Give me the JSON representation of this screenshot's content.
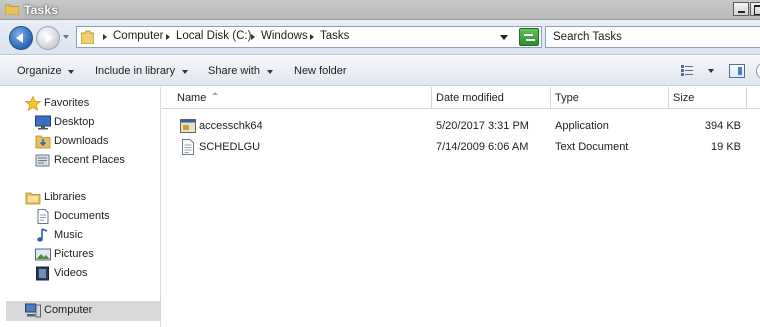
{
  "window": {
    "title": "Tasks"
  },
  "address_bar": {
    "crumbs": [
      "Computer",
      "Local Disk (C:)",
      "Windows",
      "Tasks"
    ]
  },
  "search": {
    "placeholder": "Search Tasks"
  },
  "toolbar": {
    "organize": "Organize",
    "include_in_library": "Include in library",
    "share_with": "Share with",
    "new_folder": "New folder"
  },
  "navigation": {
    "favorites_header": "Favorites",
    "favorites": [
      "Desktop",
      "Downloads",
      "Recent Places"
    ],
    "libraries_header": "Libraries",
    "libraries": [
      "Documents",
      "Music",
      "Pictures",
      "Videos"
    ],
    "computer": "Computer"
  },
  "columns": {
    "name": "Name",
    "date_modified": "Date modified",
    "type": "Type",
    "size": "Size"
  },
  "files": [
    {
      "name": "accesschk64",
      "date_modified": "5/20/2017 3:31 PM",
      "type": "Application",
      "size": "394 KB",
      "icon": "application-icon"
    },
    {
      "name": "SCHEDLGU",
      "date_modified": "7/14/2009 6:06 AM",
      "type": "Text Document",
      "size": "19 KB",
      "icon": "text-document-icon"
    }
  ],
  "colors": {
    "title_bar": "#c0c0c0",
    "address_bg": "#e4eaf3",
    "selection": "#d9d9d9"
  }
}
